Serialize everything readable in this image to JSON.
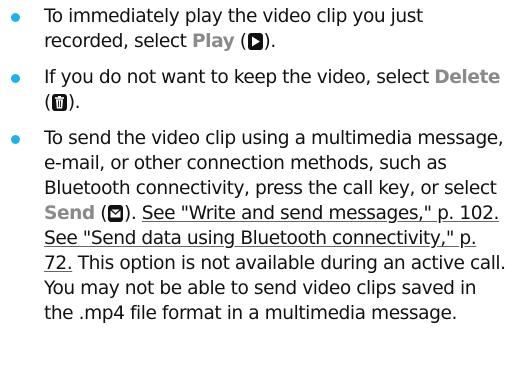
{
  "bullet_color": "#1ab3ee",
  "items": [
    {
      "text_before": "To immediately play the video clip you just recorded, select ",
      "term": "Play",
      "icon": "play-icon",
      "text_after": "."
    },
    {
      "text_before": "If you do not want to keep the video, select ",
      "term": "Delete",
      "icon": "delete-icon",
      "text_after": "."
    },
    {
      "text_before": "To send the video clip using a multimedia message, e-mail, or other connection methods, such as Bluetooth connectivity, press the call key, or select ",
      "term": "Send",
      "icon": "envelope-icon",
      "text_after": ". ",
      "link1": "See \"Write and send messages,\" p. 102.",
      "link2": "See \"Send data using Bluetooth connectivity,\" p. 72.",
      "text_end": " This option is not available during an active call. You may not be able to send video clips saved in the .mp4 file format in a multimedia message."
    }
  ]
}
